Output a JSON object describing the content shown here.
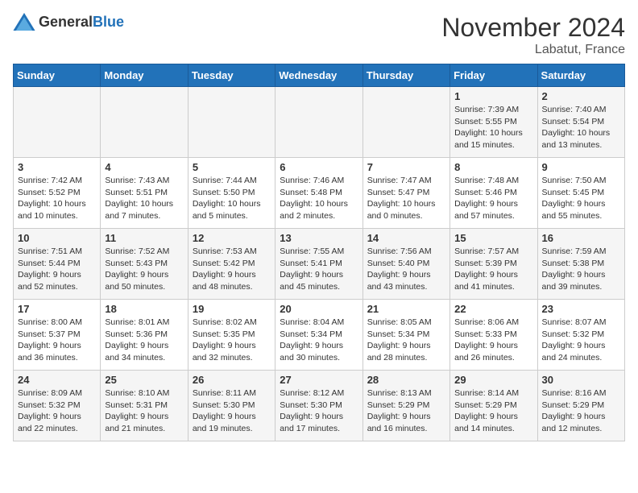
{
  "header": {
    "logo_general": "General",
    "logo_blue": "Blue",
    "title": "November 2024",
    "location": "Labatut, France"
  },
  "days_of_week": [
    "Sunday",
    "Monday",
    "Tuesday",
    "Wednesday",
    "Thursday",
    "Friday",
    "Saturday"
  ],
  "weeks": [
    [
      {
        "day": "",
        "info": ""
      },
      {
        "day": "",
        "info": ""
      },
      {
        "day": "",
        "info": ""
      },
      {
        "day": "",
        "info": ""
      },
      {
        "day": "",
        "info": ""
      },
      {
        "day": "1",
        "info": "Sunrise: 7:39 AM\nSunset: 5:55 PM\nDaylight: 10 hours and 15 minutes."
      },
      {
        "day": "2",
        "info": "Sunrise: 7:40 AM\nSunset: 5:54 PM\nDaylight: 10 hours and 13 minutes."
      }
    ],
    [
      {
        "day": "3",
        "info": "Sunrise: 7:42 AM\nSunset: 5:52 PM\nDaylight: 10 hours and 10 minutes."
      },
      {
        "day": "4",
        "info": "Sunrise: 7:43 AM\nSunset: 5:51 PM\nDaylight: 10 hours and 7 minutes."
      },
      {
        "day": "5",
        "info": "Sunrise: 7:44 AM\nSunset: 5:50 PM\nDaylight: 10 hours and 5 minutes."
      },
      {
        "day": "6",
        "info": "Sunrise: 7:46 AM\nSunset: 5:48 PM\nDaylight: 10 hours and 2 minutes."
      },
      {
        "day": "7",
        "info": "Sunrise: 7:47 AM\nSunset: 5:47 PM\nDaylight: 10 hours and 0 minutes."
      },
      {
        "day": "8",
        "info": "Sunrise: 7:48 AM\nSunset: 5:46 PM\nDaylight: 9 hours and 57 minutes."
      },
      {
        "day": "9",
        "info": "Sunrise: 7:50 AM\nSunset: 5:45 PM\nDaylight: 9 hours and 55 minutes."
      }
    ],
    [
      {
        "day": "10",
        "info": "Sunrise: 7:51 AM\nSunset: 5:44 PM\nDaylight: 9 hours and 52 minutes."
      },
      {
        "day": "11",
        "info": "Sunrise: 7:52 AM\nSunset: 5:43 PM\nDaylight: 9 hours and 50 minutes."
      },
      {
        "day": "12",
        "info": "Sunrise: 7:53 AM\nSunset: 5:42 PM\nDaylight: 9 hours and 48 minutes."
      },
      {
        "day": "13",
        "info": "Sunrise: 7:55 AM\nSunset: 5:41 PM\nDaylight: 9 hours and 45 minutes."
      },
      {
        "day": "14",
        "info": "Sunrise: 7:56 AM\nSunset: 5:40 PM\nDaylight: 9 hours and 43 minutes."
      },
      {
        "day": "15",
        "info": "Sunrise: 7:57 AM\nSunset: 5:39 PM\nDaylight: 9 hours and 41 minutes."
      },
      {
        "day": "16",
        "info": "Sunrise: 7:59 AM\nSunset: 5:38 PM\nDaylight: 9 hours and 39 minutes."
      }
    ],
    [
      {
        "day": "17",
        "info": "Sunrise: 8:00 AM\nSunset: 5:37 PM\nDaylight: 9 hours and 36 minutes."
      },
      {
        "day": "18",
        "info": "Sunrise: 8:01 AM\nSunset: 5:36 PM\nDaylight: 9 hours and 34 minutes."
      },
      {
        "day": "19",
        "info": "Sunrise: 8:02 AM\nSunset: 5:35 PM\nDaylight: 9 hours and 32 minutes."
      },
      {
        "day": "20",
        "info": "Sunrise: 8:04 AM\nSunset: 5:34 PM\nDaylight: 9 hours and 30 minutes."
      },
      {
        "day": "21",
        "info": "Sunrise: 8:05 AM\nSunset: 5:34 PM\nDaylight: 9 hours and 28 minutes."
      },
      {
        "day": "22",
        "info": "Sunrise: 8:06 AM\nSunset: 5:33 PM\nDaylight: 9 hours and 26 minutes."
      },
      {
        "day": "23",
        "info": "Sunrise: 8:07 AM\nSunset: 5:32 PM\nDaylight: 9 hours and 24 minutes."
      }
    ],
    [
      {
        "day": "24",
        "info": "Sunrise: 8:09 AM\nSunset: 5:32 PM\nDaylight: 9 hours and 22 minutes."
      },
      {
        "day": "25",
        "info": "Sunrise: 8:10 AM\nSunset: 5:31 PM\nDaylight: 9 hours and 21 minutes."
      },
      {
        "day": "26",
        "info": "Sunrise: 8:11 AM\nSunset: 5:30 PM\nDaylight: 9 hours and 19 minutes."
      },
      {
        "day": "27",
        "info": "Sunrise: 8:12 AM\nSunset: 5:30 PM\nDaylight: 9 hours and 17 minutes."
      },
      {
        "day": "28",
        "info": "Sunrise: 8:13 AM\nSunset: 5:29 PM\nDaylight: 9 hours and 16 minutes."
      },
      {
        "day": "29",
        "info": "Sunrise: 8:14 AM\nSunset: 5:29 PM\nDaylight: 9 hours and 14 minutes."
      },
      {
        "day": "30",
        "info": "Sunrise: 8:16 AM\nSunset: 5:29 PM\nDaylight: 9 hours and 12 minutes."
      }
    ]
  ]
}
